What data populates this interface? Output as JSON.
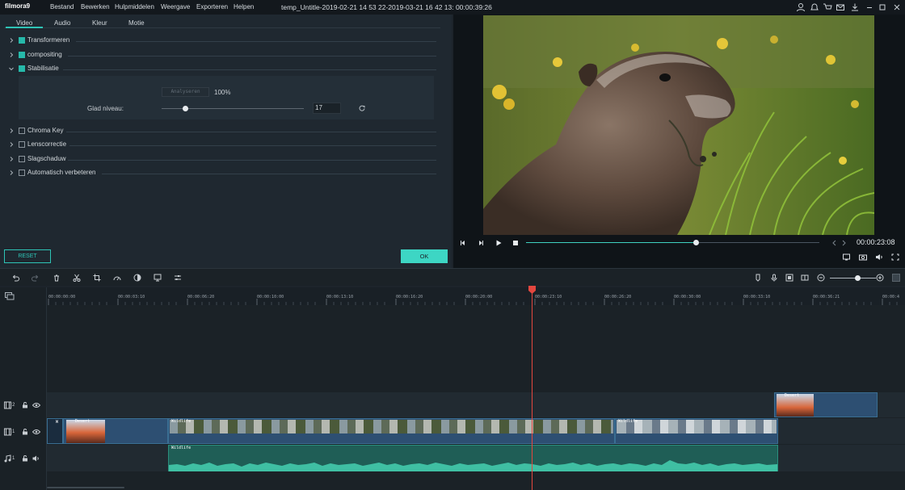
{
  "app": {
    "logo": "filmora9"
  },
  "menu": [
    "Bestand",
    "Bewerken",
    "Hulpmiddelen",
    "Weergave",
    "Exporteren",
    "Helpen"
  ],
  "doc_title": "temp_Untitle-2019-02-21 14 53 22-2019-03-21 16 42 13: 00:00:39:26",
  "tabs": [
    "Video",
    "Audio",
    "Kleur",
    "Motie"
  ],
  "sections": [
    {
      "label": "Transformeren",
      "checked": true,
      "expanded": false
    },
    {
      "label": "compositing",
      "checked": true,
      "expanded": false
    },
    {
      "label": "Stabilisatie",
      "checked": true,
      "expanded": true
    },
    {
      "label": "Chroma Key",
      "checked": false,
      "expanded": false
    },
    {
      "label": "Lenscorrectie",
      "checked": false,
      "expanded": false
    },
    {
      "label": "Slagschaduw",
      "checked": false,
      "expanded": false
    },
    {
      "label": "Automatisch verbeteren",
      "checked": false,
      "expanded": false
    }
  ],
  "stabilisatie": {
    "analyse_button": "Analyseren",
    "progress": "100%",
    "glad_label": "Glad niveau:",
    "glad_value": "17",
    "glad_fraction": 0.17
  },
  "buttons": {
    "reset": "RESET",
    "ok": "OK"
  },
  "preview": {
    "timecode": "00:00:23:08",
    "progress_fraction": 0.58
  },
  "ruler": [
    "00:00:00:00",
    "00:00:03:10",
    "00:00:06:20",
    "00:00:10:00",
    "00:00:13:10",
    "00:00:16:20",
    "00:00:20:00",
    "00:00:23:10",
    "00:00:26:20",
    "00:00:30:00",
    "00:00:33:10",
    "00:00:36:21",
    "00:00:4"
  ],
  "tracks": {
    "v2": "2",
    "v1": "1",
    "a1": "1"
  },
  "clips": {
    "desert": "Desert",
    "wildlife": "Wildlife",
    "w": "W"
  },
  "colors": {
    "accent": "#2ec4b6",
    "playhead": "#e4473f",
    "clip_blue": "#2d4f72",
    "audio_green": "#2a8f7e"
  },
  "icons": {
    "toolbar": [
      "undo-icon",
      "redo-icon",
      "delete-icon",
      "cut-icon",
      "crop-icon",
      "speed-icon",
      "color-icon",
      "green-screen-icon",
      "audio-mixer-icon"
    ]
  }
}
